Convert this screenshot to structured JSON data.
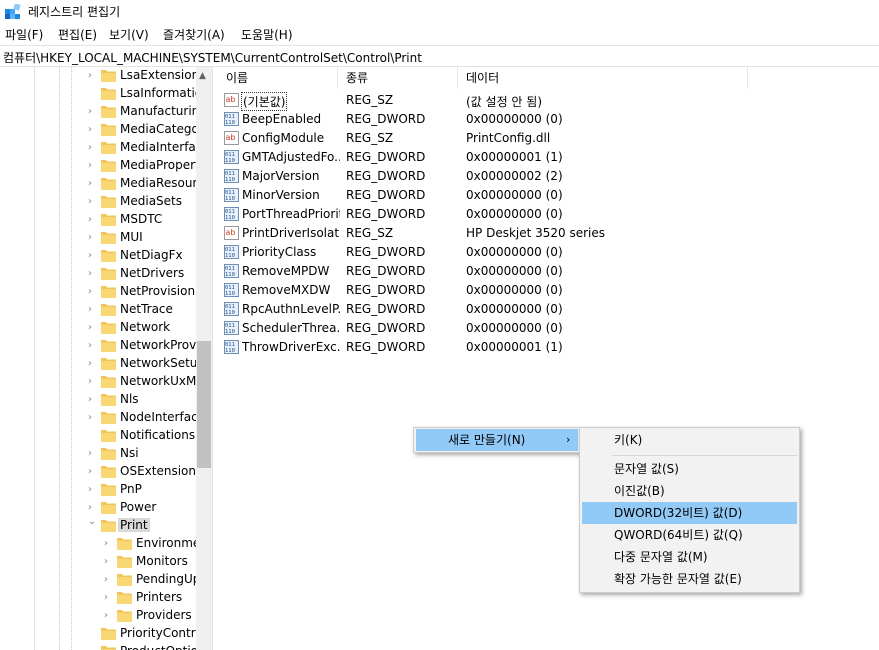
{
  "window": {
    "title": "레지스트리 편집기",
    "icon": "registry-editor-icon"
  },
  "menu": [
    "파일(F)",
    "편집(E)",
    "보기(V)",
    "즐겨찾기(A)",
    "도움말(H)"
  ],
  "address": "컴퓨터\\HKEY_LOCAL_MACHINE\\SYSTEM\\CurrentControlSet\\Control\\Print",
  "tree": {
    "items": [
      {
        "label": "LsaExtensionC",
        "level": 1,
        "expander": "collapsed"
      },
      {
        "label": "LsaInformatio",
        "level": 1,
        "expander": "none"
      },
      {
        "label": "Manufacturing",
        "level": 1,
        "expander": "collapsed"
      },
      {
        "label": "MediaCategor",
        "level": 1,
        "expander": "collapsed"
      },
      {
        "label": "MediaInterface",
        "level": 1,
        "expander": "collapsed"
      },
      {
        "label": "MediaProperti",
        "level": 1,
        "expander": "collapsed"
      },
      {
        "label": "MediaResourc",
        "level": 1,
        "expander": "collapsed"
      },
      {
        "label": "MediaSets",
        "level": 1,
        "expander": "collapsed"
      },
      {
        "label": "MSDTC",
        "level": 1,
        "expander": "collapsed"
      },
      {
        "label": "MUI",
        "level": 1,
        "expander": "collapsed"
      },
      {
        "label": "NetDiagFx",
        "level": 1,
        "expander": "collapsed"
      },
      {
        "label": "NetDrivers",
        "level": 1,
        "expander": "collapsed"
      },
      {
        "label": "NetProvision",
        "level": 1,
        "expander": "collapsed"
      },
      {
        "label": "NetTrace",
        "level": 1,
        "expander": "collapsed"
      },
      {
        "label": "Network",
        "level": 1,
        "expander": "collapsed"
      },
      {
        "label": "NetworkProvic",
        "level": 1,
        "expander": "collapsed"
      },
      {
        "label": "NetworkSetup",
        "level": 1,
        "expander": "collapsed"
      },
      {
        "label": "NetworkUxMa",
        "level": 1,
        "expander": "collapsed"
      },
      {
        "label": "Nls",
        "level": 1,
        "expander": "collapsed"
      },
      {
        "label": "NodeInterface",
        "level": 1,
        "expander": "collapsed"
      },
      {
        "label": "Notifications",
        "level": 1,
        "expander": "none"
      },
      {
        "label": "Nsi",
        "level": 1,
        "expander": "collapsed"
      },
      {
        "label": "OSExtensionD",
        "level": 1,
        "expander": "collapsed"
      },
      {
        "label": "PnP",
        "level": 1,
        "expander": "collapsed"
      },
      {
        "label": "Power",
        "level": 1,
        "expander": "collapsed"
      },
      {
        "label": "Print",
        "level": 1,
        "expander": "expanded",
        "selected": true
      },
      {
        "label": "Environme",
        "level": 2,
        "expander": "collapsed"
      },
      {
        "label": "Monitors",
        "level": 2,
        "expander": "collapsed"
      },
      {
        "label": "PendingUp",
        "level": 2,
        "expander": "collapsed"
      },
      {
        "label": "Printers",
        "level": 2,
        "expander": "collapsed"
      },
      {
        "label": "Providers",
        "level": 2,
        "expander": "collapsed"
      },
      {
        "label": "PriorityContro",
        "level": 1,
        "expander": "none"
      },
      {
        "label": "ProductOptio",
        "level": 1,
        "expander": "none"
      }
    ]
  },
  "list": {
    "columns": [
      "이름",
      "종류",
      "데이터"
    ],
    "rows": [
      {
        "name": "(기본값)",
        "type": "REG_SZ",
        "data": "(값 설정 안 됨)",
        "icon": "string-value-icon"
      },
      {
        "name": "BeepEnabled",
        "type": "REG_DWORD",
        "data": "0x00000000 (0)",
        "icon": "binary-value-icon"
      },
      {
        "name": "ConfigModule",
        "type": "REG_SZ",
        "data": "PrintConfig.dll",
        "icon": "string-value-icon"
      },
      {
        "name": "GMTAdjustedFo...",
        "type": "REG_DWORD",
        "data": "0x00000001 (1)",
        "icon": "binary-value-icon"
      },
      {
        "name": "MajorVersion",
        "type": "REG_DWORD",
        "data": "0x00000002 (2)",
        "icon": "binary-value-icon"
      },
      {
        "name": "MinorVersion",
        "type": "REG_DWORD",
        "data": "0x00000000 (0)",
        "icon": "binary-value-icon"
      },
      {
        "name": "PortThreadPriority",
        "type": "REG_DWORD",
        "data": "0x00000000 (0)",
        "icon": "binary-value-icon"
      },
      {
        "name": "PrintDriverIsolat...",
        "type": "REG_SZ",
        "data": "HP Deskjet 3520 series",
        "icon": "string-value-icon"
      },
      {
        "name": "PriorityClass",
        "type": "REG_DWORD",
        "data": "0x00000000 (0)",
        "icon": "binary-value-icon"
      },
      {
        "name": "RemoveMPDW",
        "type": "REG_DWORD",
        "data": "0x00000000 (0)",
        "icon": "binary-value-icon"
      },
      {
        "name": "RemoveMXDW",
        "type": "REG_DWORD",
        "data": "0x00000000 (0)",
        "icon": "binary-value-icon"
      },
      {
        "name": "RpcAuthnLevelP...",
        "type": "REG_DWORD",
        "data": "0x00000000 (0)",
        "icon": "binary-value-icon"
      },
      {
        "name": "SchedulerThrea...",
        "type": "REG_DWORD",
        "data": "0x00000000 (0)",
        "icon": "binary-value-icon"
      },
      {
        "name": "ThrowDriverExc...",
        "type": "REG_DWORD",
        "data": "0x00000001 (1)",
        "icon": "binary-value-icon"
      }
    ]
  },
  "context_menu": {
    "new_label": "새로 만들기(N)",
    "submenu": [
      "키(K)",
      "문자열 값(S)",
      "이진값(B)",
      "DWORD(32비트) 값(D)",
      "QWORD(64비트) 값(Q)",
      "다중 문자열 값(M)",
      "확장 가능한 문자열 값(E)"
    ],
    "highlighted": "DWORD(32비트) 값(D)"
  },
  "colors": {
    "menu_highlight": "#91c9f7",
    "folder": "#f4c558",
    "selection": "#d9d9d9"
  }
}
